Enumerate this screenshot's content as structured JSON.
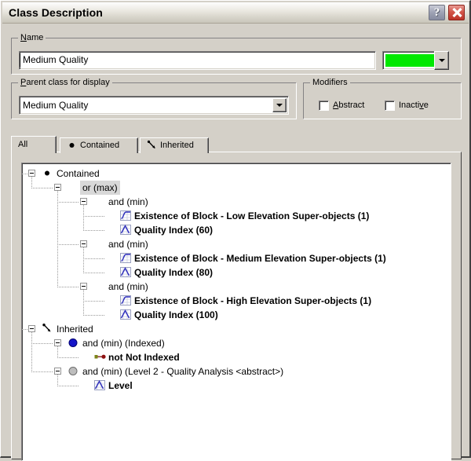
{
  "window": {
    "title": "Class Description",
    "help_button": "?",
    "close_button": "✕"
  },
  "name_group": {
    "legend_prefix": "N",
    "legend_rest": "ame",
    "value": "Medium Quality",
    "color": "#00e800",
    "color_dropdown_icon": "chevron-down-icon"
  },
  "parent_group": {
    "legend_prefix": "P",
    "legend_rest": "arent class for display",
    "value": "Medium Quality",
    "dropdown_icon": "chevron-down-icon"
  },
  "modifiers_group": {
    "legend": "Modifiers",
    "items": [
      {
        "label_prefix": "",
        "label_accel": "A",
        "label_rest": "bstract",
        "checked": false
      },
      {
        "label_prefix": "Inacti",
        "label_accel": "v",
        "label_rest": "e",
        "checked": false
      }
    ]
  },
  "tabs": [
    {
      "label": "All",
      "icon": "",
      "active": true
    },
    {
      "label": "Contained",
      "icon": "dot-icon",
      "active": false
    },
    {
      "label": "Inherited",
      "icon": "inherit-arrow-icon",
      "active": false
    }
  ],
  "tree": [
    {
      "label": "Contained",
      "level": 0,
      "icon": "dot-icon",
      "bold": false,
      "selected": false,
      "expander": true
    },
    {
      "label": "or (max)",
      "level": 1,
      "icon": "none",
      "bold": false,
      "selected": true,
      "expander": true
    },
    {
      "label": "and (min)",
      "level": 2,
      "icon": "none",
      "bold": false,
      "selected": false,
      "expander": true
    },
    {
      "label": "Existence of Block - Low Elevation Super-objects  (1)",
      "level": 3,
      "icon": "sigmoid-icon",
      "bold": true,
      "selected": false,
      "expander": false
    },
    {
      "label": "Quality Index (60)",
      "level": 3,
      "icon": "triangle-icon",
      "bold": true,
      "selected": false,
      "expander": false
    },
    {
      "label": "and (min)",
      "level": 2,
      "icon": "none",
      "bold": false,
      "selected": false,
      "expander": true
    },
    {
      "label": "Existence of Block - Medium Elevation Super-objects  (1)",
      "level": 3,
      "icon": "sigmoid-icon",
      "bold": true,
      "selected": false,
      "expander": false
    },
    {
      "label": "Quality Index (80)",
      "level": 3,
      "icon": "triangle-icon",
      "bold": true,
      "selected": false,
      "expander": false
    },
    {
      "label": "and (min)",
      "level": 2,
      "icon": "none",
      "bold": false,
      "selected": false,
      "expander": true
    },
    {
      "label": "Existence of Block - High Elevation Super-objects  (1)",
      "level": 3,
      "icon": "sigmoid-icon",
      "bold": true,
      "selected": false,
      "expander": false
    },
    {
      "label": "Quality Index (100)",
      "level": 3,
      "icon": "triangle-icon",
      "bold": true,
      "selected": false,
      "expander": false
    },
    {
      "label": "Inherited",
      "level": 0,
      "icon": "inherit-arrow-icon",
      "bold": false,
      "selected": false,
      "expander": true
    },
    {
      "label": "and (min) (Indexed)",
      "level": 1,
      "icon": "blue-circle-icon",
      "bold": false,
      "selected": false,
      "expander": true
    },
    {
      "label": "not Not Indexed",
      "level": 2,
      "icon": "not-icon",
      "bold": true,
      "selected": false,
      "expander": false
    },
    {
      "label": "and (min) (Level 2 - Quality Analysis <abstract>)",
      "level": 1,
      "icon": "gray-circle-icon",
      "bold": false,
      "selected": false,
      "expander": true
    },
    {
      "label": "Level",
      "level": 2,
      "icon": "triangle-icon",
      "bold": true,
      "selected": false,
      "expander": false
    }
  ]
}
